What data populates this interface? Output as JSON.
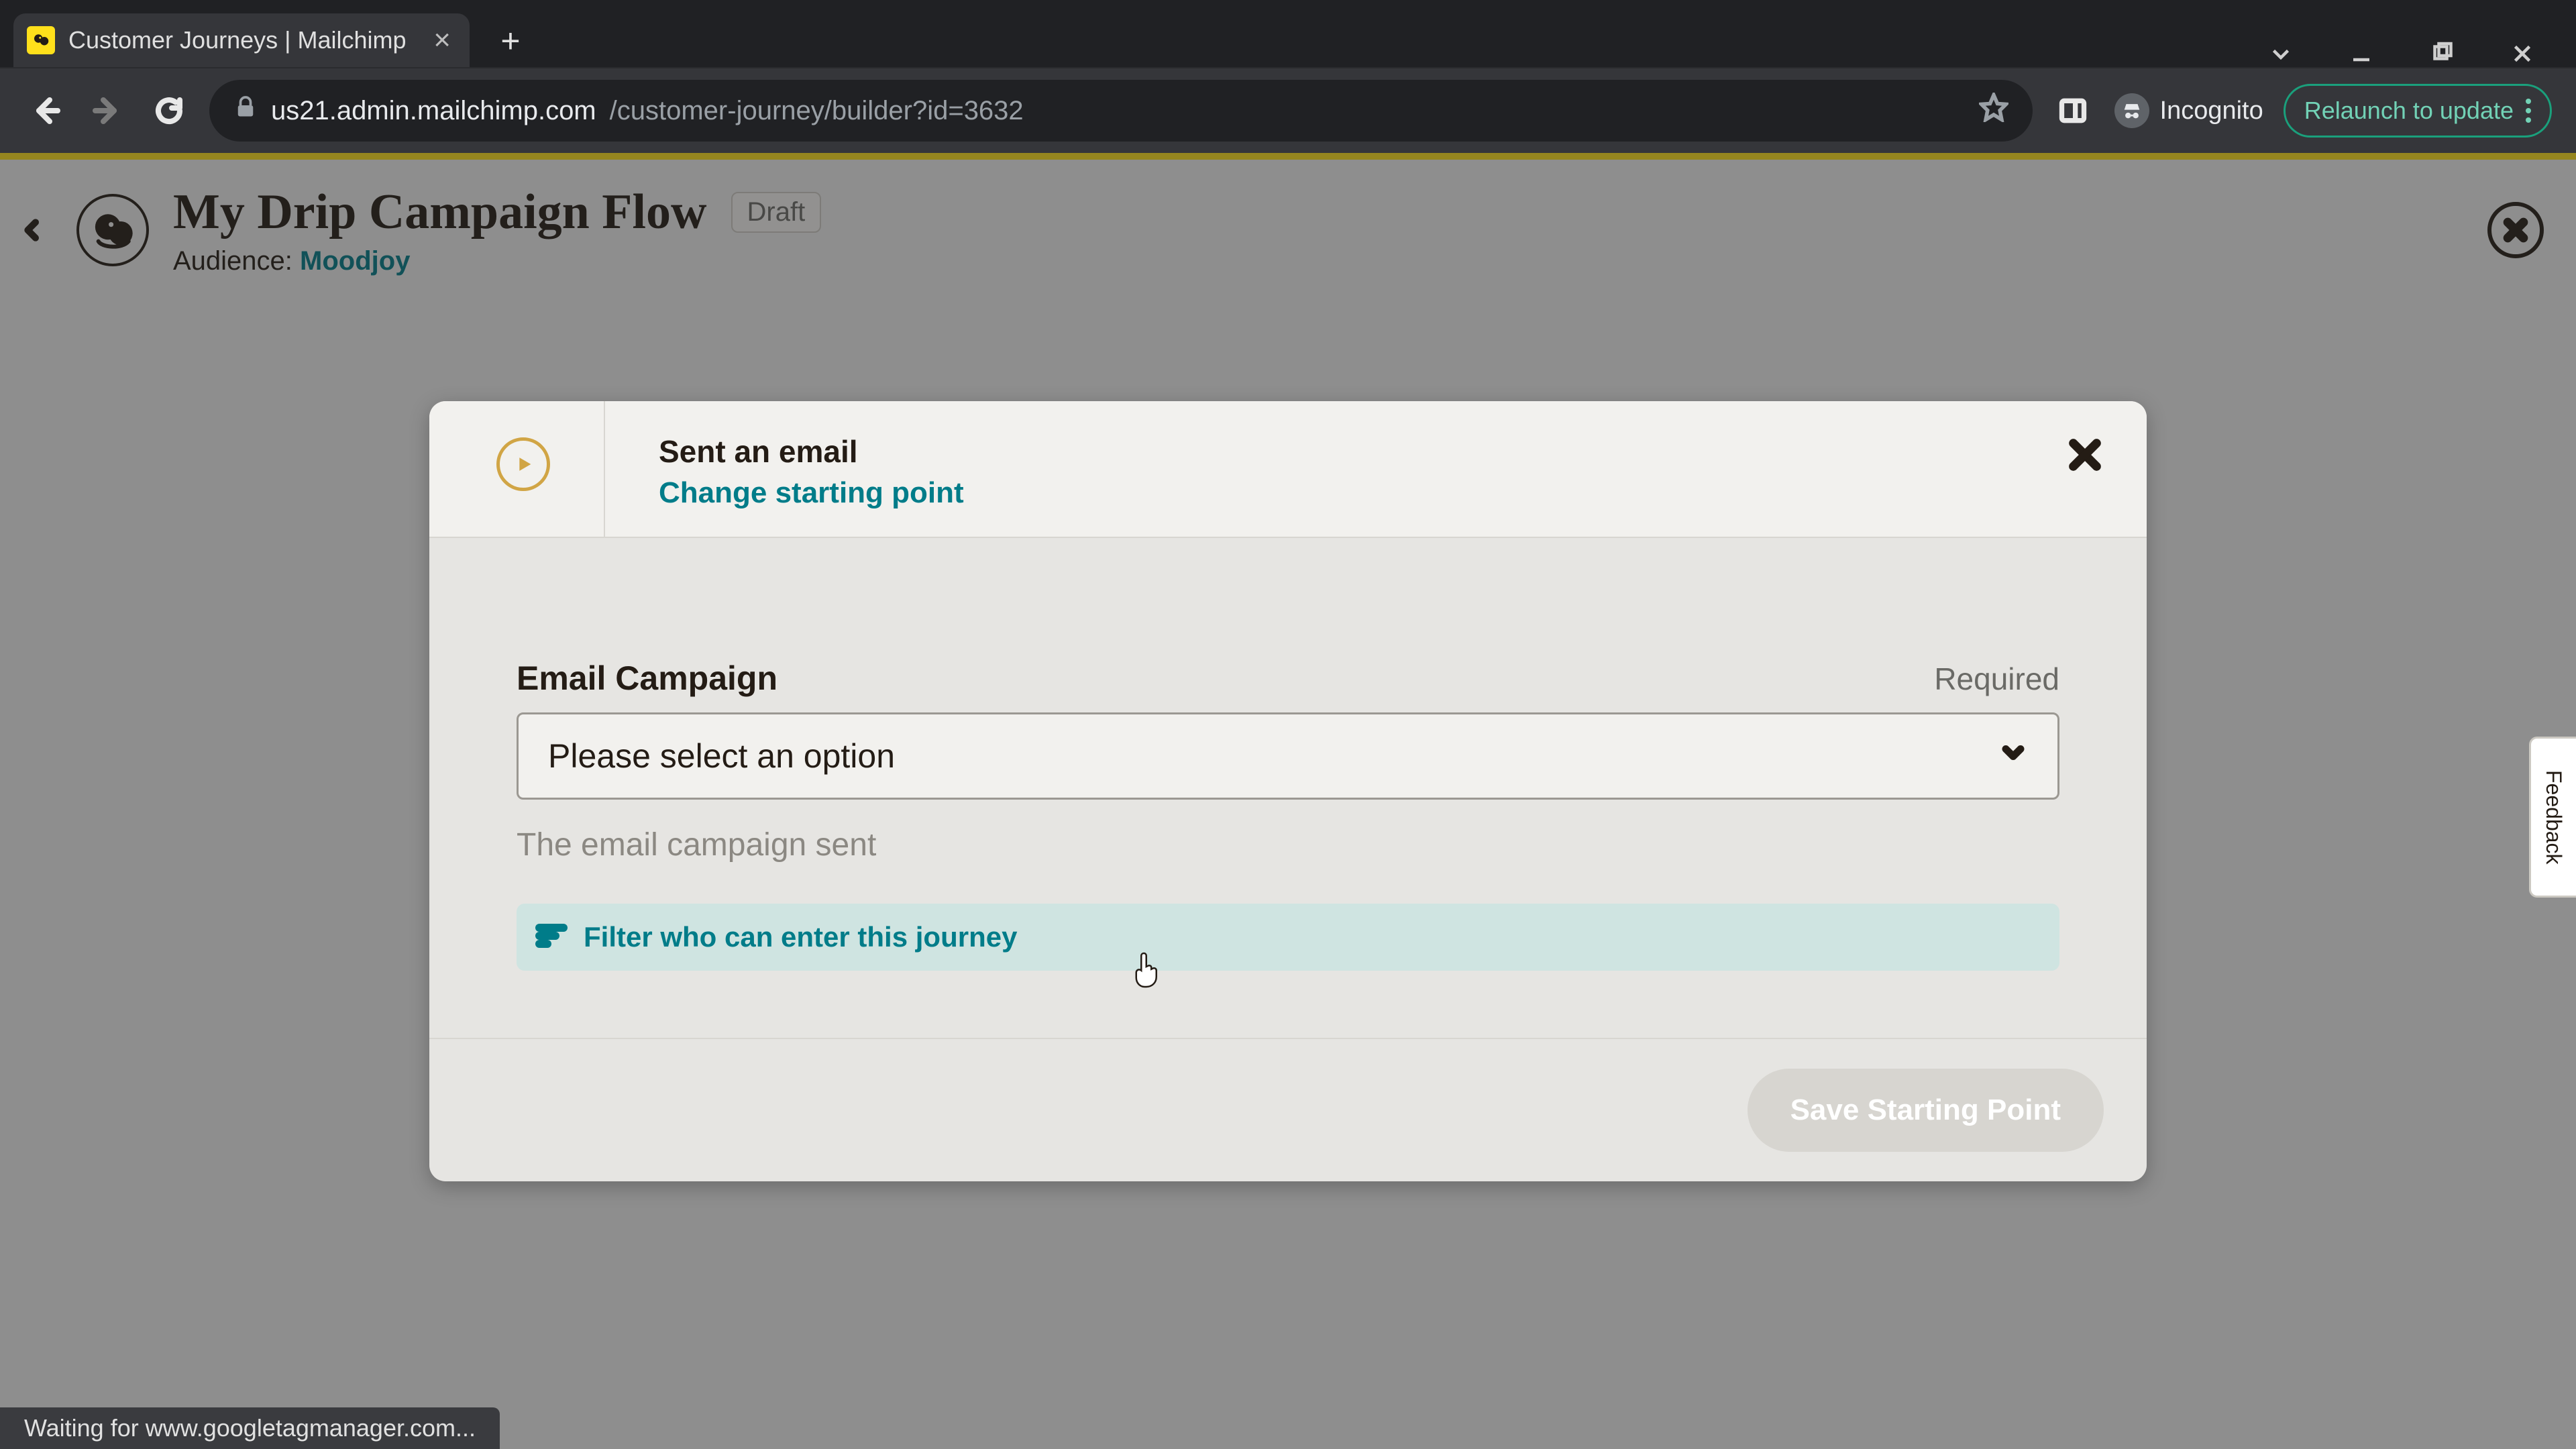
{
  "browser": {
    "tab_title": "Customer Journeys | Mailchimp",
    "new_tab_label": "+",
    "url_host": "us21.admin.mailchimp.com",
    "url_path": "/customer-journey/builder?id=3632",
    "incognito_label": "Incognito",
    "relaunch_label": "Relaunch to update"
  },
  "app_header": {
    "title": "My Drip Campaign Flow",
    "status": "Draft",
    "audience_label": "Audience: ",
    "audience_name": "Moodjoy"
  },
  "modal": {
    "icon_semantic": "play-circle",
    "title": "Sent an email",
    "change_link": "Change starting point",
    "field_label": "Email Campaign",
    "required_label": "Required",
    "select_placeholder": "Please select an option",
    "helper_text": "The email campaign sent",
    "filter_label": "Filter who can enter this journey",
    "save_label": "Save Starting Point"
  },
  "feedback_tab": "Feedback",
  "status_text": "Waiting for www.googletagmanager.com...",
  "colors": {
    "teal": "#007c89",
    "teal_bg": "#cfe4e1",
    "gold": "#d1a545",
    "brand_yellow": "#ffe01b",
    "ink": "#241c15"
  }
}
